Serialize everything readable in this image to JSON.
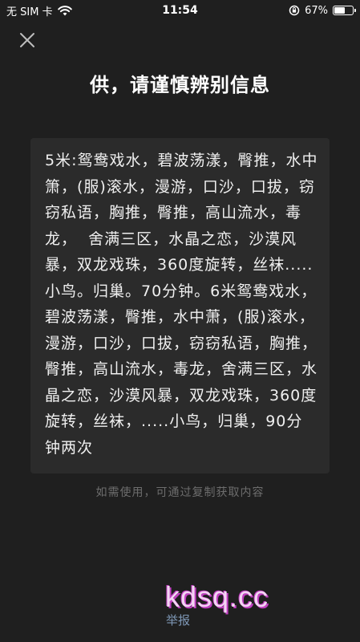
{
  "status_bar": {
    "carrier": "无 SIM 卡",
    "time": "11:54",
    "battery_percent_text": "67%",
    "battery_level": 0.67,
    "icons": [
      "wifi-icon",
      "lock-rotation-icon",
      "battery-icon"
    ]
  },
  "header": {
    "close_icon": "close-icon",
    "title": "供，请谨慎辨别信息"
  },
  "card": {
    "text": "5米:鸳鸯戏水，碧波荡漾，臀推，水中箫，(服)滚水，漫游，口沙，口拔，窃窃私语，胸推，臀推，高山流水，毒龙，  舍满三区，水晶之恋，沙漠风暴，双龙戏珠，360度旋转，丝袜.....小鸟。归巢。70分钟。6米鸳鸯戏水，碧波荡漾，臀推，水中萧，(服)滚水，漫游，口沙，口拔，窃窃私语，胸推，臀推，高山流水，毒龙，舍满三区，水晶之恋，沙漠风暴，双龙戏珠，360度旋转，丝袜，.....小鸟，归巢，90分钟两次"
  },
  "hint": "如需使用，可通过复制获取内容",
  "watermark": "kdsq.cc",
  "report_label": "举报",
  "colors": {
    "background": "#1f1f1f",
    "card_background": "#2b2b2b",
    "hint": "#6d6d6d",
    "report_link": "#7e97b5",
    "watermark": "#f3d4f3"
  }
}
